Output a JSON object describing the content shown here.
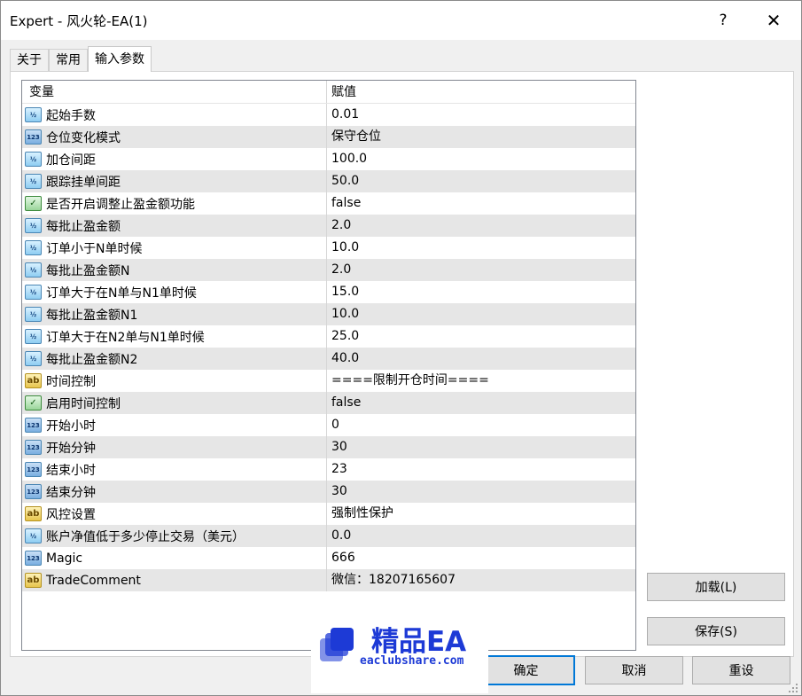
{
  "window": {
    "title": "Expert - 风火轮-EA(1)",
    "help_glyph": "?",
    "close_glyph": "✕"
  },
  "tabs": [
    {
      "label": "关于",
      "active": false
    },
    {
      "label": "常用",
      "active": false
    },
    {
      "label": "输入参数",
      "active": true
    }
  ],
  "grid": {
    "headers": {
      "variable": "变量",
      "value": "赋值"
    },
    "rows": [
      {
        "type": "double",
        "icon_text": "½",
        "name": "起始手数",
        "value": "0.01"
      },
      {
        "type": "int",
        "icon_text": "123",
        "name": "仓位变化模式",
        "value": "保守仓位"
      },
      {
        "type": "double",
        "icon_text": "½",
        "name": "加仓间距",
        "value": "100.0"
      },
      {
        "type": "double",
        "icon_text": "½",
        "name": "跟踪挂单间距",
        "value": "50.0"
      },
      {
        "type": "bool",
        "icon_text": "✓",
        "name": "是否开启调整止盈金额功能",
        "value": "false"
      },
      {
        "type": "double",
        "icon_text": "½",
        "name": "每批止盈金额",
        "value": "2.0"
      },
      {
        "type": "double",
        "icon_text": "½",
        "name": "订单小于N单时候",
        "value": "10.0"
      },
      {
        "type": "double",
        "icon_text": "½",
        "name": "每批止盈金额N",
        "value": "2.0"
      },
      {
        "type": "double",
        "icon_text": "½",
        "name": "订单大于在N单与N1单时候",
        "value": "15.0"
      },
      {
        "type": "double",
        "icon_text": "½",
        "name": "每批止盈金额N1",
        "value": "10.0"
      },
      {
        "type": "double",
        "icon_text": "½",
        "name": "订单大于在N2单与N1单时候",
        "value": "25.0"
      },
      {
        "type": "double",
        "icon_text": "½",
        "name": "每批止盈金额N2",
        "value": "40.0"
      },
      {
        "type": "str",
        "icon_text": "ab",
        "name": "时间控制",
        "value": "====限制开仓时间===="
      },
      {
        "type": "bool",
        "icon_text": "✓",
        "name": "启用时间控制",
        "value": "false"
      },
      {
        "type": "int",
        "icon_text": "123",
        "name": "开始小时",
        "value": "0"
      },
      {
        "type": "int",
        "icon_text": "123",
        "name": "开始分钟",
        "value": "30"
      },
      {
        "type": "int",
        "icon_text": "123",
        "name": "结束小时",
        "value": "23"
      },
      {
        "type": "int",
        "icon_text": "123",
        "name": "结束分钟",
        "value": "30"
      },
      {
        "type": "str",
        "icon_text": "ab",
        "name": "风控设置",
        "value": "强制性保护"
      },
      {
        "type": "double",
        "icon_text": "½",
        "name": "账户净值低于多少停止交易（美元）",
        "value": "0.0"
      },
      {
        "type": "int",
        "icon_text": "123",
        "name": "Magic",
        "value": "666"
      },
      {
        "type": "str",
        "icon_text": "ab",
        "name": "TradeComment",
        "value": "微信：18207165607"
      }
    ]
  },
  "buttons": {
    "load": "加载(L)",
    "save": "保存(S)",
    "ok": "确定",
    "cancel": "取消",
    "reset": "重设"
  },
  "watermark": {
    "title": "精品EA",
    "subtitle": "eaclubshare.com",
    "color": "#1d3ad6"
  }
}
